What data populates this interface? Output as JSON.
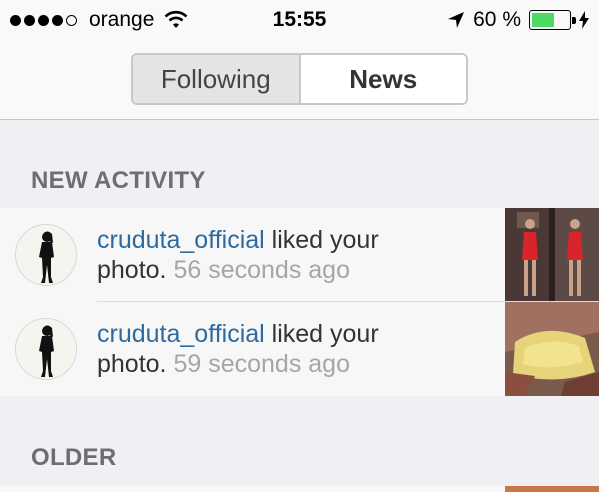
{
  "status_bar": {
    "carrier": "orange",
    "time": "15:55",
    "battery_percent": "60 %",
    "battery_level": 0.6,
    "signal_bars_filled": 4,
    "signal_bars_total": 5
  },
  "segmented": {
    "tabs": [
      {
        "label": "Following",
        "selected": false
      },
      {
        "label": "News",
        "selected": true
      }
    ]
  },
  "sections": {
    "new_activity_header": "NEW ACTIVITY",
    "older_header": "OLDER"
  },
  "activity": [
    {
      "username": "cruduta_official",
      "action": " liked your",
      "action2": "photo.",
      "time_ago": "56 seconds ago"
    },
    {
      "username": "cruduta_official",
      "action": " liked your",
      "action2": "photo.",
      "time_ago": "59 seconds ago"
    }
  ],
  "colors": {
    "username": "#2c6aa0",
    "battery": "#4cd964",
    "background": "#efeff4"
  }
}
